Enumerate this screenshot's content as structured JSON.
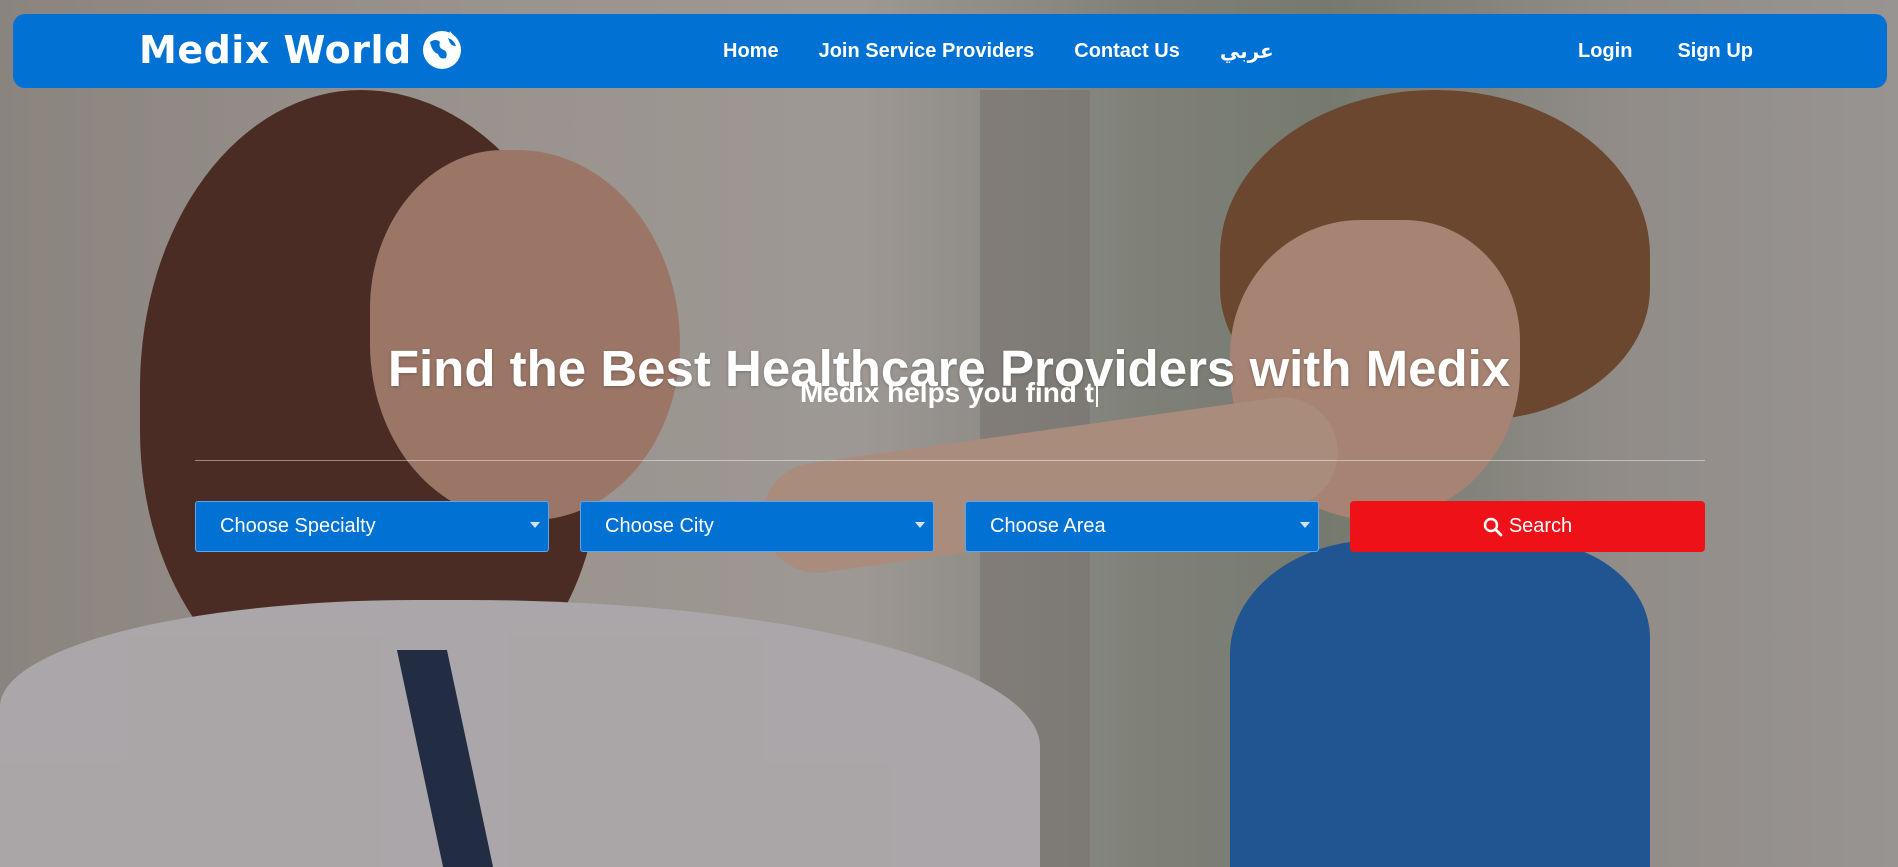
{
  "navbar": {
    "brand": "Medix World",
    "links": [
      "Home",
      "Join Service Providers",
      "Contact Us",
      "عربي"
    ],
    "login": "Login",
    "signup": "Sign Up"
  },
  "hero": {
    "title": "Find the Best Healthcare Providers with Medix",
    "subtitle": "Medix helps you find t"
  },
  "search": {
    "specialty_label": "Choose Specialty",
    "city_label": "Choose City",
    "area_label": "Choose Area",
    "button_label": "Search"
  },
  "colors": {
    "primary": "#0171d3",
    "search_button": "#ee1117"
  },
  "icons": [
    "globe-icon",
    "chevron-down-icon",
    "search-icon"
  ]
}
